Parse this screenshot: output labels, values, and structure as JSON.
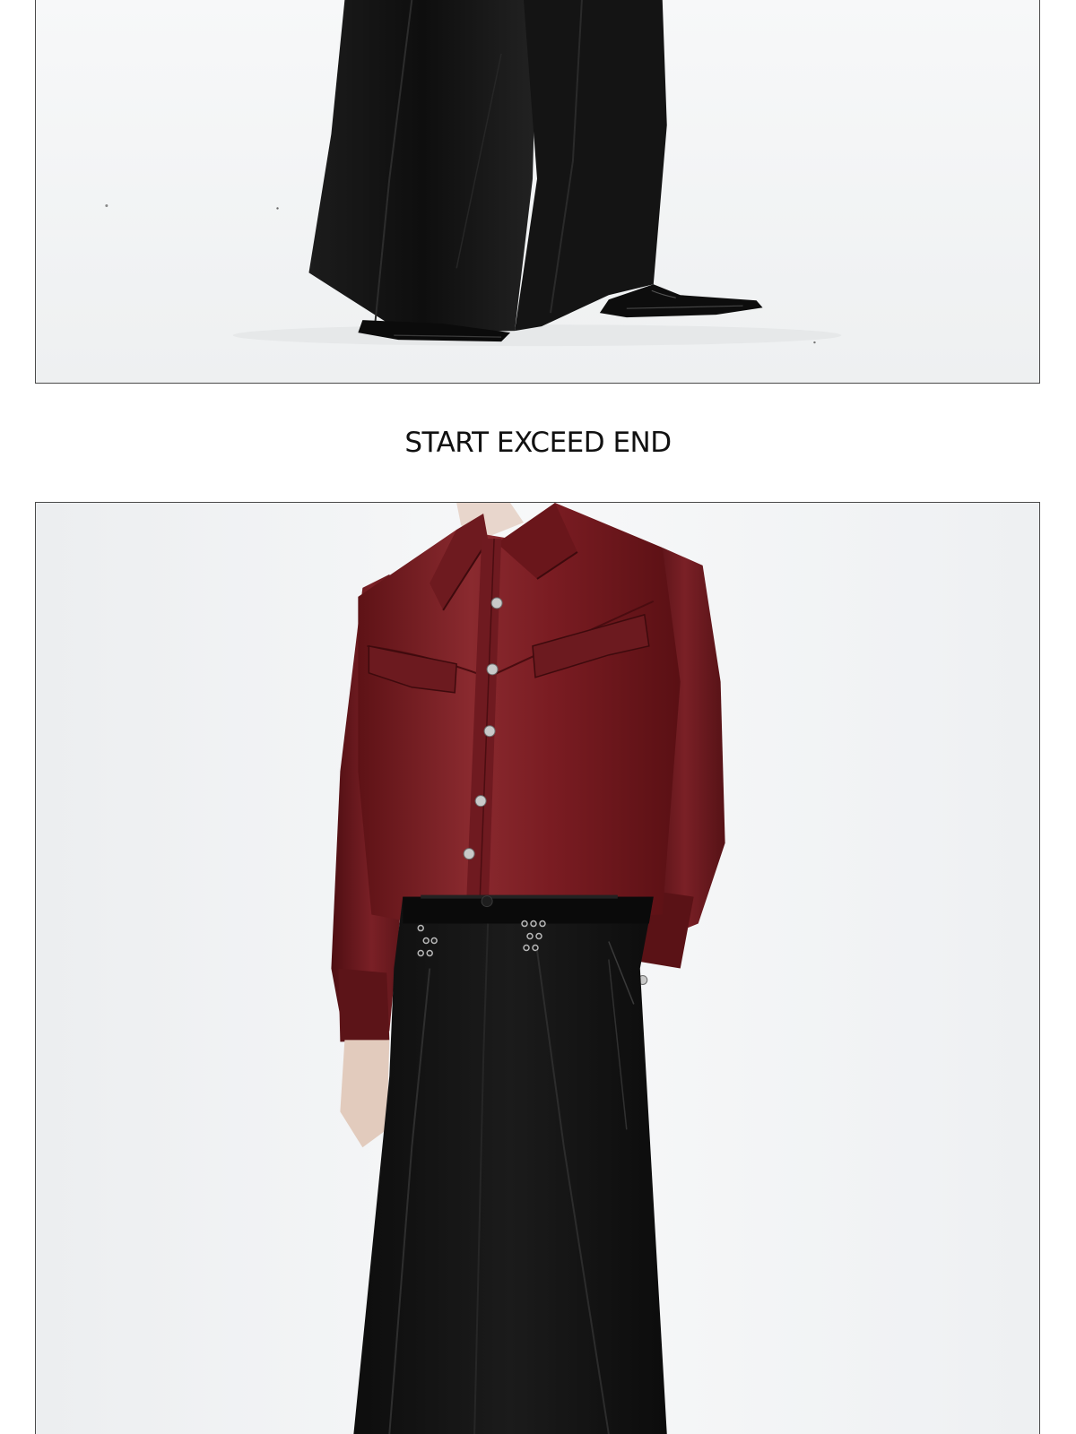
{
  "brand": {
    "title": "START EXCEED END"
  },
  "photos": [
    {
      "name": "product-photo-trousers-and-shoes"
    },
    {
      "name": "product-photo-burgundy-shirt"
    }
  ],
  "colors": {
    "background": "#ffffff",
    "shirt": "#7a1c22",
    "trousers": "#131313",
    "frame_border": "#4a4a4a"
  }
}
